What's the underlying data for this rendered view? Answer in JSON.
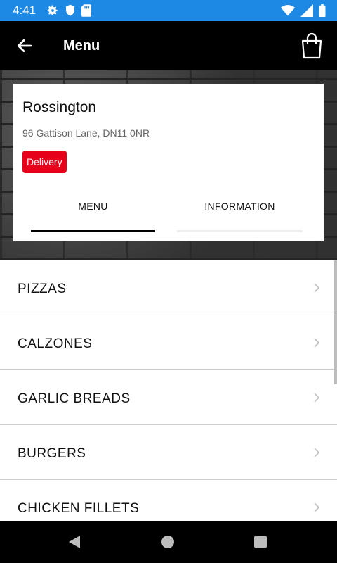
{
  "status_bar": {
    "time": "4:41",
    "left_icons": [
      "gear-icon",
      "shield-icon",
      "sd-card-icon"
    ],
    "right_icons": [
      "wifi-icon",
      "signal-icon",
      "battery-icon"
    ],
    "color": "#1e88e5"
  },
  "app_bar": {
    "title": "Menu",
    "back_icon": "arrow-left-icon",
    "cart_icon": "shopping-bag-icon"
  },
  "store": {
    "name": "Rossington",
    "address": "96 Gattison Lane, DN11 0NR",
    "badge": "Delivery",
    "badge_color": "#e6001a"
  },
  "tabs": [
    {
      "label": "MENU",
      "selected": true
    },
    {
      "label": "INFORMATION",
      "selected": false
    }
  ],
  "categories": [
    {
      "label": "PIZZAS"
    },
    {
      "label": "CALZONES"
    },
    {
      "label": "GARLIC BREADS"
    },
    {
      "label": "BURGERS"
    },
    {
      "label": "CHICKEN FILLETS"
    }
  ]
}
